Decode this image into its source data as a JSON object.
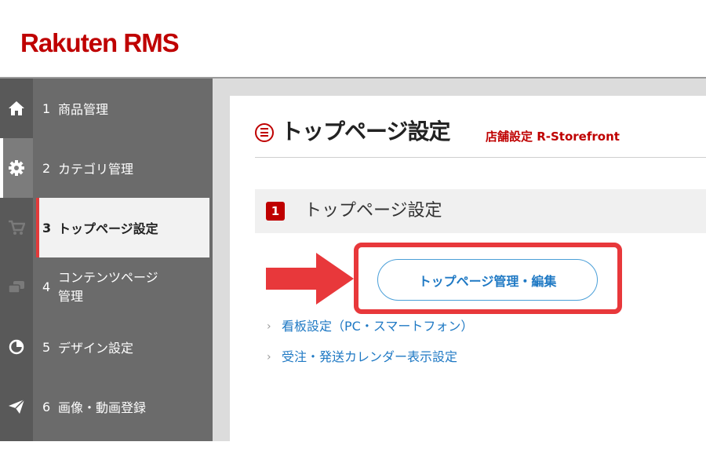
{
  "header": {
    "logo": "Rakuten RMS"
  },
  "sidebar": {
    "items": [
      {
        "num": "1",
        "label": "商品管理",
        "icon": "home-icon"
      },
      {
        "num": "2",
        "label": "カテゴリ管理",
        "icon": "gear-icon"
      },
      {
        "num": "3",
        "label": "トップページ設定",
        "icon": "cart-icon"
      },
      {
        "num": "4",
        "label_line1": "コンテンツページ",
        "label_line2": "管理",
        "icon": "pages-icon"
      },
      {
        "num": "5",
        "label": "デザイン設定",
        "icon": "pie-chart-icon"
      },
      {
        "num": "6",
        "label": "画像・動画登録",
        "icon": "paper-plane-icon"
      }
    ]
  },
  "main": {
    "title": "トップページ設定",
    "subtitle": "店舗設定 R-Storefront",
    "section": {
      "num": "1",
      "title": "トップページ設定"
    },
    "primary_button": "トップページ管理・編集",
    "links": [
      "看板設定（PC・スマートフォン）",
      "受注・発送カレンダー表示設定"
    ]
  },
  "colors": {
    "brand": "#bf0000",
    "highlight": "#e8383b",
    "link": "#1f79c4",
    "sidebar": "#6b6b6b"
  }
}
